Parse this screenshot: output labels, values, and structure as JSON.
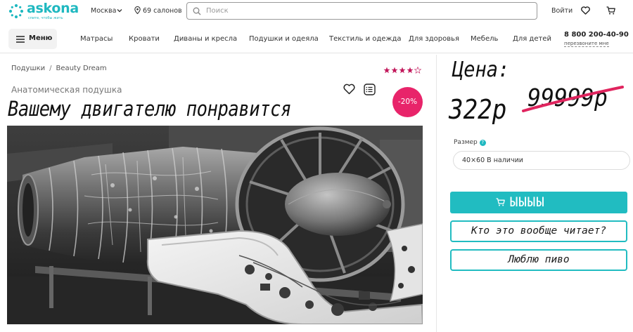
{
  "header": {
    "logo_text": "askona",
    "logo_tagline": "спите, чтобы жить",
    "city": "Москва",
    "salons": "69 салонов",
    "search_placeholder": "Поиск",
    "login": "Войти"
  },
  "nav": {
    "menu_label": "Меню",
    "items": [
      "Матрасы",
      "Кровати",
      "Диваны и кресла",
      "Подушки и одеяла",
      "Текстиль и одежда",
      "Для здоровья",
      "Мебель",
      "Для детей"
    ],
    "phone": "8 800 200-40-90",
    "callback": "перезвоните мне"
  },
  "product": {
    "breadcrumb": [
      "Подушки",
      "Beauty Dream"
    ],
    "rating": 4.5,
    "category": "Анатомическая подушка",
    "discount": "-20%",
    "title": "Вашему двигателю понравится",
    "image": "jet-engine-photo"
  },
  "purchase": {
    "price_label": "Цена:",
    "price": "322р",
    "old_price": "99999р",
    "size_label": "Размер",
    "size_value": "40×60 В наличии",
    "cart_button": "ЫЫЫЫ",
    "question_button": "Кто это вообще читает?",
    "beer_button": "Люблю пиво"
  },
  "colors": {
    "brand": "#21bcc1",
    "discount": "#e8246a"
  }
}
